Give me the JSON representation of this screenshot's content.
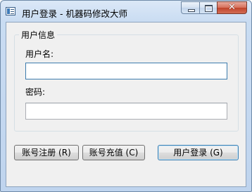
{
  "window": {
    "title": "用户登录 - 机器码修改大师",
    "close_glyph": "✕"
  },
  "group": {
    "legend": "用户信息",
    "username_label": "用户名:",
    "username_value": "",
    "password_label": "密码:",
    "password_value": ""
  },
  "buttons": {
    "register": "账号注册 (R)",
    "recharge": "账号充值 (C)",
    "login": "用户登录 (G)"
  }
}
